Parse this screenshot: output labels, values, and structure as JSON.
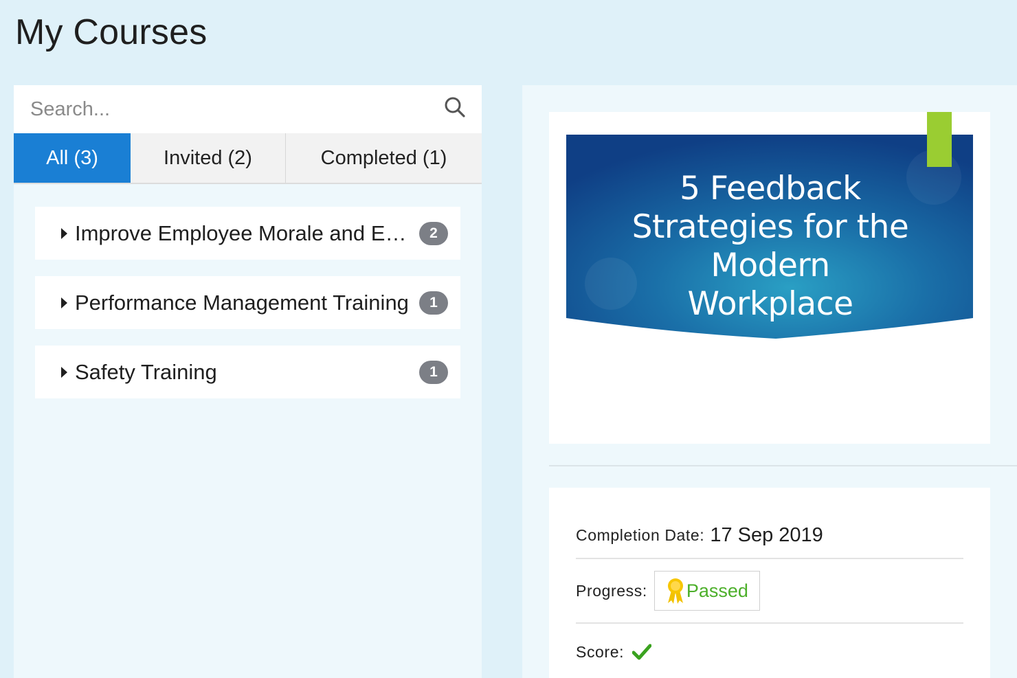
{
  "page": {
    "title": "My Courses"
  },
  "search": {
    "placeholder": "Search..."
  },
  "tabs": [
    {
      "label": "All (3)",
      "active": true
    },
    {
      "label": "Invited (2)",
      "active": false
    },
    {
      "label": "Completed (1)",
      "active": false
    }
  ],
  "courses": [
    {
      "name": "Improve Employee Morale and Engagement",
      "count": "2"
    },
    {
      "name": "Performance Management Training",
      "count": "1"
    },
    {
      "name": "Safety Training",
      "count": "1"
    }
  ],
  "selected_course": {
    "thumbnail_lines": [
      "5 Feedback",
      "Strategies for the",
      "Modern",
      "Workplace"
    ],
    "completion_label": "Completion Date:",
    "completion_date": "17 Sep 2019",
    "progress_label": "Progress:",
    "progress_value": "Passed",
    "score_label": "Score:"
  },
  "icons": {
    "search": "search-icon",
    "caret": "caret-right-icon",
    "ribbon": "award-ribbon-icon",
    "check": "checkmark-icon"
  },
  "colors": {
    "background": "#dff1f9",
    "panel": "#eef8fc",
    "active_tab": "#1a7fd4",
    "badge": "#7c7f86",
    "passed_green": "#4caf2a",
    "thumb_accent": "#9acd32"
  }
}
